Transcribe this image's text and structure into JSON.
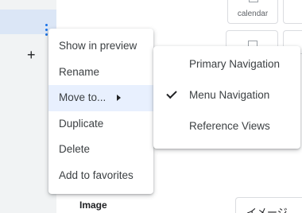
{
  "background": {
    "tile_calendar_label": "calendar",
    "image_label": "Image",
    "bottom_tile_text": "イメージ"
  },
  "context_menu": {
    "items": [
      {
        "label": "Show in preview"
      },
      {
        "label": "Rename"
      },
      {
        "label": "Move to..."
      },
      {
        "label": "Duplicate"
      },
      {
        "label": "Delete"
      },
      {
        "label": "Add to favorites"
      }
    ],
    "highlighted_item": "Move to..."
  },
  "submenu": {
    "items": [
      {
        "label": "Primary Navigation",
        "checked": false
      },
      {
        "label": "Menu Navigation",
        "checked": true
      },
      {
        "label": "Reference Views",
        "checked": false
      }
    ]
  },
  "colors": {
    "selection_blue": "#1a73e8",
    "row_highlight": "#dbe6f6",
    "menu_hover": "#e8f0fe"
  },
  "icons": [
    "kebab-icon",
    "plus-icon",
    "submenu-arrow-icon",
    "check-icon",
    "calendar-icon"
  ]
}
